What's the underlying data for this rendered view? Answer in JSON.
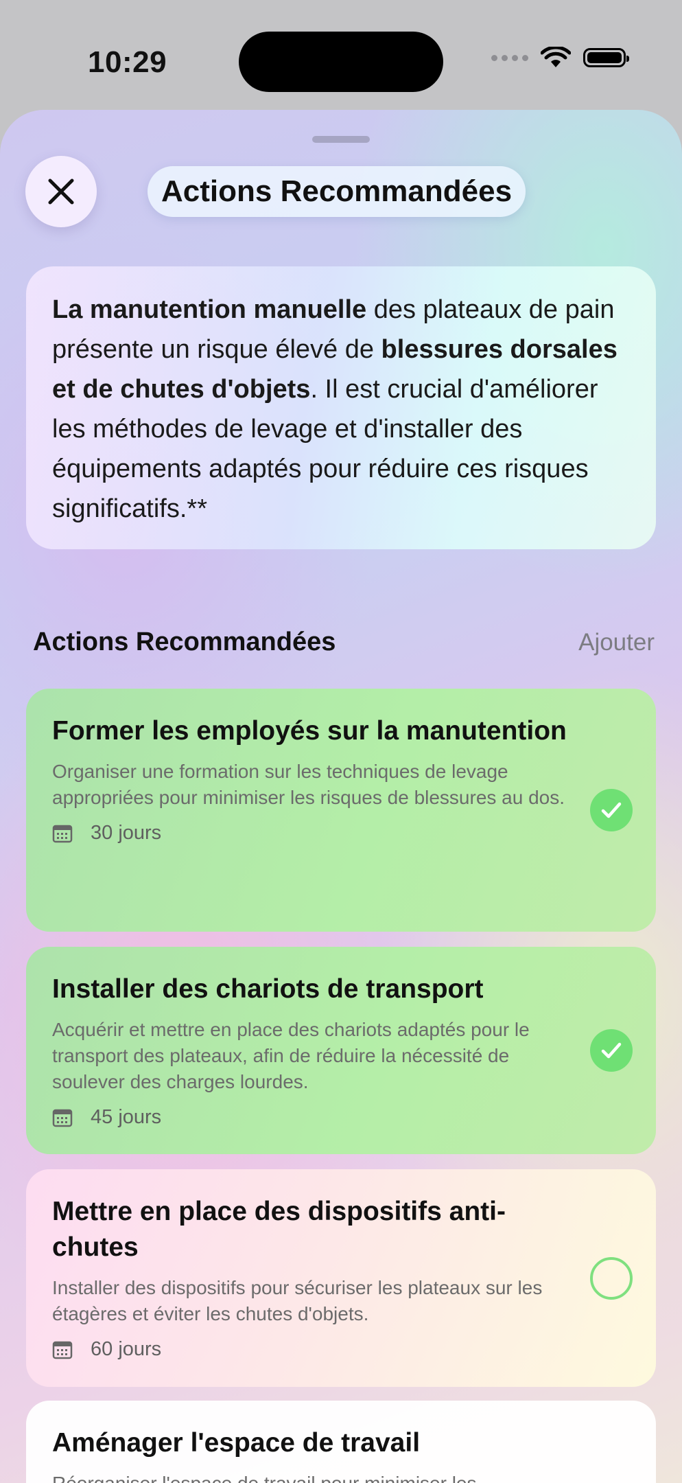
{
  "status_bar": {
    "time": "10:29"
  },
  "header": {
    "title": "Actions Recommandées"
  },
  "summary": {
    "segments": [
      {
        "text": "La manutention manuelle",
        "bold": true
      },
      {
        "text": " des plateaux de pain présente un risque élevé de ",
        "bold": false
      },
      {
        "text": "blessures dorsales et de chutes d'objets",
        "bold": true
      },
      {
        "text": ". Il est crucial d'améliorer les méthodes de levage et d'installer des équipements adaptés pour réduire ces risques significatifs.**",
        "bold": false
      }
    ]
  },
  "section": {
    "title": "Actions Recommandées",
    "add_label": "Ajouter"
  },
  "actions": [
    {
      "title": "Former les employés sur la manutention",
      "description": "Organiser une formation sur les techniques de levage appropriées pour minimiser les risques de blessures au dos.",
      "duration": "30 jours",
      "completed": true
    },
    {
      "title": "Installer des chariots de transport",
      "description": "Acquérir et mettre en place des chariots adaptés pour le transport des plateaux, afin de réduire la nécessité de soulever des charges lourdes.",
      "duration": "45 jours",
      "completed": true
    },
    {
      "title": "Mettre en place des dispositifs anti-chutes",
      "description": "Installer des dispositifs pour sécuriser les plateaux sur les étagères et éviter les chutes d'objets.",
      "duration": "60 jours",
      "completed": false
    },
    {
      "title": "Aménager l'espace de travail",
      "description": "Réorganiser l'espace de travail pour minimiser les",
      "duration": "",
      "completed": false
    }
  ],
  "colors": {
    "check_green": "#6fe074",
    "check_ring": "#7fe07f",
    "secondary_text": "#6b6b6b",
    "link_gray": "#7c7c82"
  },
  "icons": {
    "close": "close-icon",
    "calendar": "calendar-icon",
    "check": "checkmark-icon",
    "wifi": "wifi-icon",
    "battery": "battery-icon"
  }
}
